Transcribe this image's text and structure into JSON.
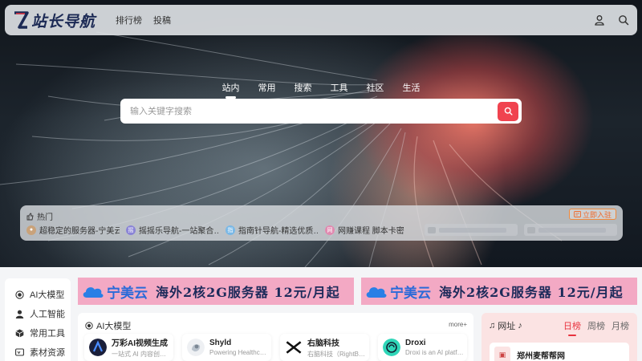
{
  "header": {
    "logo_text": "站长导航",
    "nav": [
      "排行榜",
      "投稿"
    ],
    "icons": [
      "user-icon",
      "search-icon"
    ]
  },
  "search": {
    "tabs": [
      "站内",
      "常用",
      "搜索",
      "工具",
      "社区",
      "生活"
    ],
    "active_tab": "站内",
    "placeholder": "输入关键字搜索",
    "value": ""
  },
  "hot": {
    "title": "热门",
    "join_label": "立即入驻",
    "items": [
      {
        "label": "超稳定的服务器-宁美云",
        "icon_color": "#c9a27a",
        "icon_char": "宁"
      },
      {
        "label": "摇摇乐导航-一站聚合…",
        "icon_color": "#8a84d6",
        "icon_char": "摇"
      },
      {
        "label": "指南针导航-精选优质…",
        "icon_color": "#7ab8e6",
        "icon_char": "指"
      },
      {
        "label": "网赚课程 脚本卡密",
        "icon_color": "#e08ab0",
        "icon_char": "网"
      }
    ]
  },
  "sidebar": {
    "items": [
      {
        "label": "AI大模型",
        "icon": "radio-icon"
      },
      {
        "label": "人工智能",
        "icon": "user-icon"
      },
      {
        "label": "常用工具",
        "icon": "cube-icon"
      },
      {
        "label": "素材资源",
        "icon": "tv-icon"
      }
    ]
  },
  "banners": [
    {
      "brand": "宁美云",
      "text": "海外2核2G服务器 12元/月起"
    },
    {
      "brand": "宁美云",
      "text": "海外2核2G服务器 12元/月起"
    }
  ],
  "category": {
    "title": "AI大模型",
    "more": "more+",
    "cards": [
      {
        "name": "万彩AI视频生成",
        "desc": "一站式 AI 内容创…",
        "icon": "wancai-icon"
      },
      {
        "name": "Shyld",
        "desc": "Powering Healthc…",
        "icon": "shyld-icon"
      },
      {
        "name": "右脑科技",
        "desc": "右脑科技（RightB…",
        "icon": "rightbrain-icon"
      },
      {
        "name": "Droxi",
        "desc": "Droxi is an AI platf…",
        "icon": "droxi-icon"
      }
    ]
  },
  "ranking": {
    "title": "网址",
    "tabs": [
      "日榜",
      "周榜",
      "月榜"
    ],
    "active_tab": "日榜",
    "top_item": "郑州麦帮帮网"
  },
  "colors": {
    "accent": "#f0434f",
    "banner_bg": "#f3a9c4",
    "rank_bg": "#fbe3e3"
  }
}
